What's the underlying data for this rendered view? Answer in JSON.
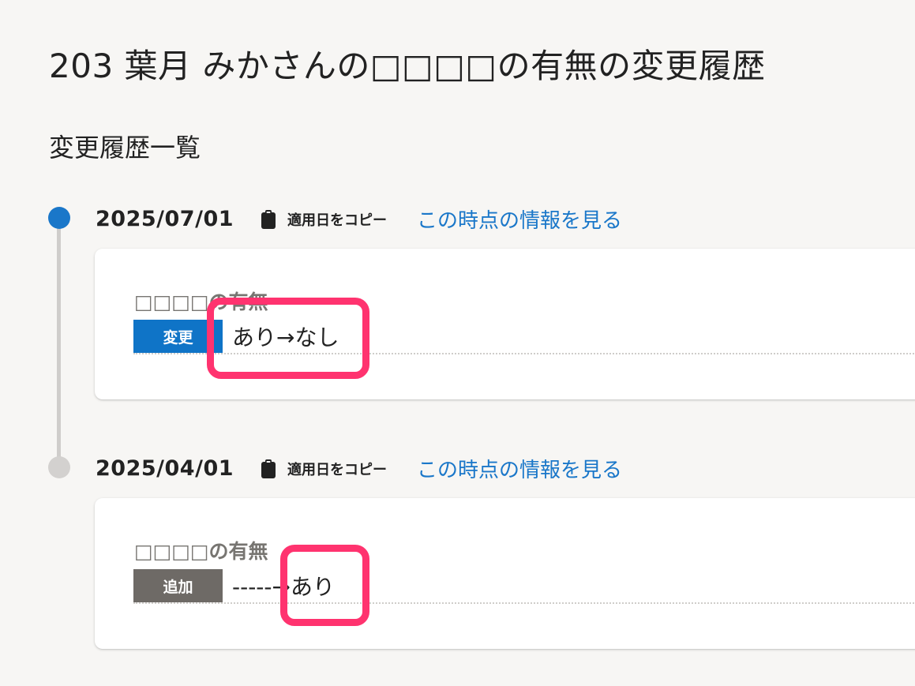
{
  "page": {
    "title": "203 葉月 みかさんの□□□□の有無の変更履歴"
  },
  "history": {
    "section_title": "変更履歴一覧",
    "entries": [
      {
        "date": "2025/07/01",
        "copy_label": "適用日をコピー",
        "view_link": "この時点の情報を見る",
        "status": "current",
        "field_label": "□□□□の有無",
        "badge": "変更",
        "badge_color": "#0f74c7",
        "value": "あり→なし"
      },
      {
        "date": "2025/04/01",
        "copy_label": "適用日をコピー",
        "view_link": "この時点の情報を見る",
        "status": "past",
        "field_label": "□□□□の有無",
        "badge": "追加",
        "badge_color": "#6e6a66",
        "value": "-----→あり"
      }
    ]
  },
  "colors": {
    "accent": "#1a77c9",
    "highlight": "#ff336f",
    "background": "#f7f6f4"
  },
  "icons": {
    "copy": "clipboard-icon"
  }
}
